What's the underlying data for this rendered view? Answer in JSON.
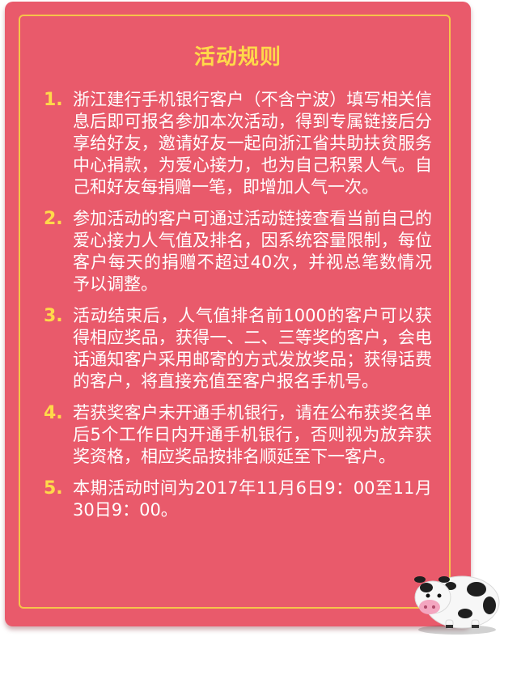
{
  "title": "活动规则",
  "rules": [
    {
      "num": "1.",
      "text": "浙江建行手机银行客户（不含宁波）填写相关信息后即可报名参加本次活动，得到专属链接后分享给好友，邀请好友一起向浙江省共助扶贫服务中心捐款，为爱心接力，也为自己积累人气。自己和好友每捐赠一笔，即增加人气一次。"
    },
    {
      "num": "2.",
      "text": "参加活动的客户可通过活动链接查看当前自己的爱心接力人气值及排名，因系统容量限制，每位客户每天的捐赠不超过40次，并视总笔数情况予以调整。"
    },
    {
      "num": "3.",
      "text": "活动结束后，人气值排名前1000的客户可以获得相应奖品，获得一、二、三等奖的客户，会电话通知客户采用邮寄的方式发放奖品；获得话费的客户，将直接充值至客户报名手机号。"
    },
    {
      "num": "4.",
      "text": "若获奖客户未开通手机银行，请在公布获奖名单后5个工作日内开通手机银行，否则视为放弃获奖资格，相应奖品按排名顺延至下一客户。"
    },
    {
      "num": "5.",
      "text": "本期活动时间为2017年11月6日9：00至11月30日9：00。"
    }
  ],
  "colors": {
    "card": "#e95a6b",
    "border": "#f6c44a",
    "accent": "#ffd94a",
    "text": "#ffffff"
  },
  "mascot": "cow-mascot-icon"
}
